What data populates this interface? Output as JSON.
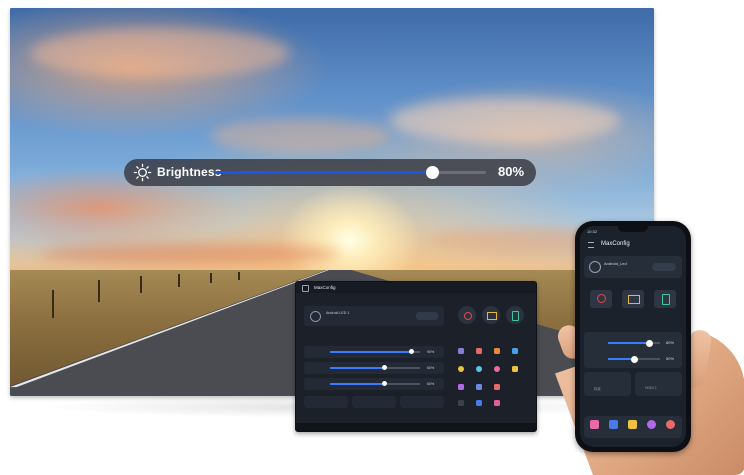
{
  "display": {
    "brightness_label": "Brightness",
    "brightness_value_text": "80%",
    "brightness_level": 0.8,
    "accent_color": "#1a56e8"
  },
  "tablet": {
    "app_title": "MaxConfig",
    "device_name": "Android LED 1",
    "slider_values": [
      "90%",
      "60%",
      "60%"
    ],
    "slider_levels": [
      0.9,
      0.6,
      0.6
    ]
  },
  "phone": {
    "status_time": "10:32",
    "app_title": "MaxConfig",
    "device_name": "Android_Led",
    "sliders": [
      {
        "value_text": "80%",
        "level": 0.8
      },
      {
        "value_text": "50%",
        "level": 0.5
      }
    ],
    "tiles": [
      {
        "value_text": "标准"
      },
      {
        "value_text": "HDMI 2"
      }
    ]
  },
  "icons": [
    "sun-icon",
    "menu-icon",
    "power-icon",
    "check-icon"
  ],
  "colors": {
    "accent": "#3b7cff",
    "panel": "#1c222c",
    "card": "#262e3a"
  }
}
